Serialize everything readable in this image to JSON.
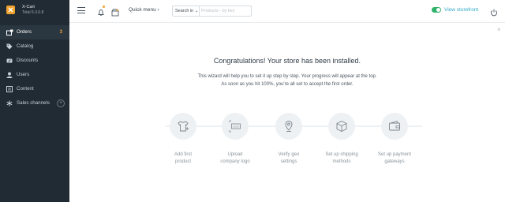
{
  "brand": {
    "name": "X-Cart",
    "version": "Total 5.3.6.8"
  },
  "sidebar": {
    "items": [
      {
        "label": "Orders",
        "badge": "3",
        "icon": "orders-icon"
      },
      {
        "label": "Catalog",
        "icon": "tag-icon"
      },
      {
        "label": "Discounts",
        "icon": "discount-icon"
      },
      {
        "label": "Users",
        "icon": "user-icon"
      },
      {
        "label": "Content",
        "icon": "content-icon"
      },
      {
        "label": "Sales channels",
        "icon": "asterisk-icon",
        "action": "+"
      }
    ]
  },
  "topbar": {
    "quick_menu": "Quick menu ›",
    "search_in": "Search in ⌄",
    "search_placeholder": "Products - by key",
    "view_storefront": "View storefront"
  },
  "main": {
    "close": "×",
    "title": "Congratulations! Your store has been installed.",
    "desc_line1": "This wizard will help you to set it up step by step. Your progress will appear at the top.",
    "desc_line2": "As soon as you hit 100%, you're all set to accept the first order.",
    "steps": [
      {
        "label1": "Add first",
        "label2": "product",
        "icon": "tshirt-icon"
      },
      {
        "label1": "Upload",
        "label2": "company logo",
        "icon": "logo-icon"
      },
      {
        "label1": "Verify geo",
        "label2": "settings",
        "icon": "location-pin-icon"
      },
      {
        "label1": "Set up shipping",
        "label2": "methods",
        "icon": "box-icon"
      },
      {
        "label1": "Set up payment",
        "label2": "gateways",
        "icon": "wallet-icon"
      }
    ]
  },
  "colors": {
    "sidebar_bg": "#212b33",
    "accent": "#f0a22e",
    "link": "#2fa8c9",
    "toggle_on": "#2fb36b"
  }
}
